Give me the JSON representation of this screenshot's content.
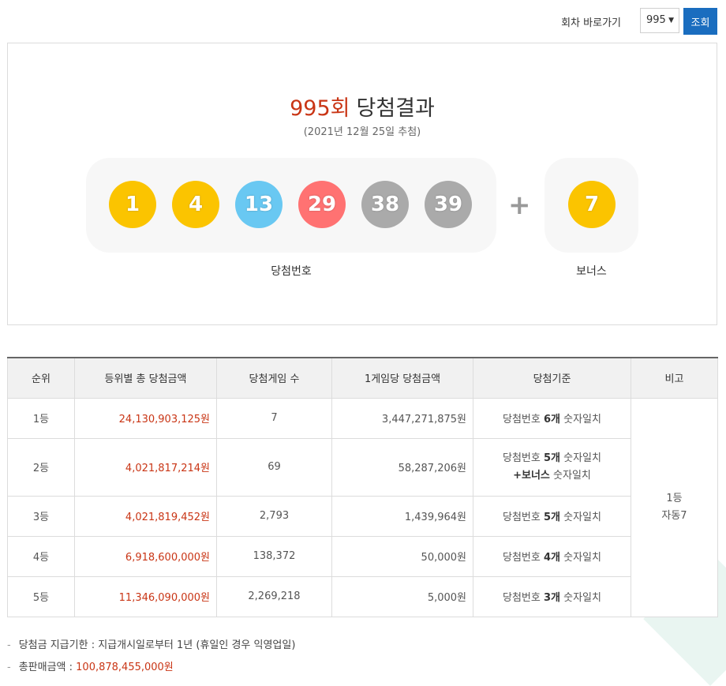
{
  "topbar": {
    "goto_label": "회차 바로가기",
    "round_select": "995",
    "search_button": "조회"
  },
  "result": {
    "round": "995회",
    "title_suffix": "당첨결과",
    "draw_date": "(2021년 12월 25일 추첨)",
    "numbers": [
      "1",
      "4",
      "13",
      "29",
      "38",
      "39"
    ],
    "number_colors": [
      "#fbc400",
      "#fbc400",
      "#69c8f2",
      "#ff7272",
      "#aaaaaa",
      "#aaaaaa"
    ],
    "plus": "+",
    "bonus": "7",
    "bonus_color": "#fbc400",
    "numbers_caption": "당첨번호",
    "bonus_caption": "보너스"
  },
  "table": {
    "headers": [
      "순위",
      "등위별 총 당첨금액",
      "당첨게임 수",
      "1게임당 당첨금액",
      "당첨기준",
      "비고"
    ],
    "rows": [
      {
        "rank": "1등",
        "total": "24,130,903,125원",
        "games": "7",
        "per_game": "3,447,271,875원",
        "crit_pre": "당첨번호 ",
        "crit_bold": "6개",
        "crit_post": " 숫자일치"
      },
      {
        "rank": "2등",
        "total": "4,021,817,214원",
        "games": "69",
        "per_game": "58,287,206원",
        "crit_pre": "당첨번호 ",
        "crit_bold": "5개",
        "crit_post": " 숫자일치",
        "crit2_bold": "+보너스",
        "crit2_post": " 숫자일치"
      },
      {
        "rank": "3등",
        "total": "4,021,819,452원",
        "games": "2,793",
        "per_game": "1,439,964원",
        "crit_pre": "당첨번호 ",
        "crit_bold": "5개",
        "crit_post": " 숫자일치"
      },
      {
        "rank": "4등",
        "total": "6,918,600,000원",
        "games": "138,372",
        "per_game": "50,000원",
        "crit_pre": "당첨번호 ",
        "crit_bold": "4개",
        "crit_post": " 숫자일치"
      },
      {
        "rank": "5등",
        "total": "11,346,090,000원",
        "games": "2,269,218",
        "per_game": "5,000원",
        "crit_pre": "당첨번호 ",
        "crit_bold": "3개",
        "crit_post": " 숫자일치"
      }
    ],
    "note_line1": "1등",
    "note_line2": "자동7"
  },
  "notes": {
    "dash": "-",
    "deadline": "당첨금 지급기한 : 지급개시일로부터 1년 (휴일인 경우 익영업일)",
    "sales_label": "총판매금액 : ",
    "sales_amount": "100,878,455,000원"
  }
}
